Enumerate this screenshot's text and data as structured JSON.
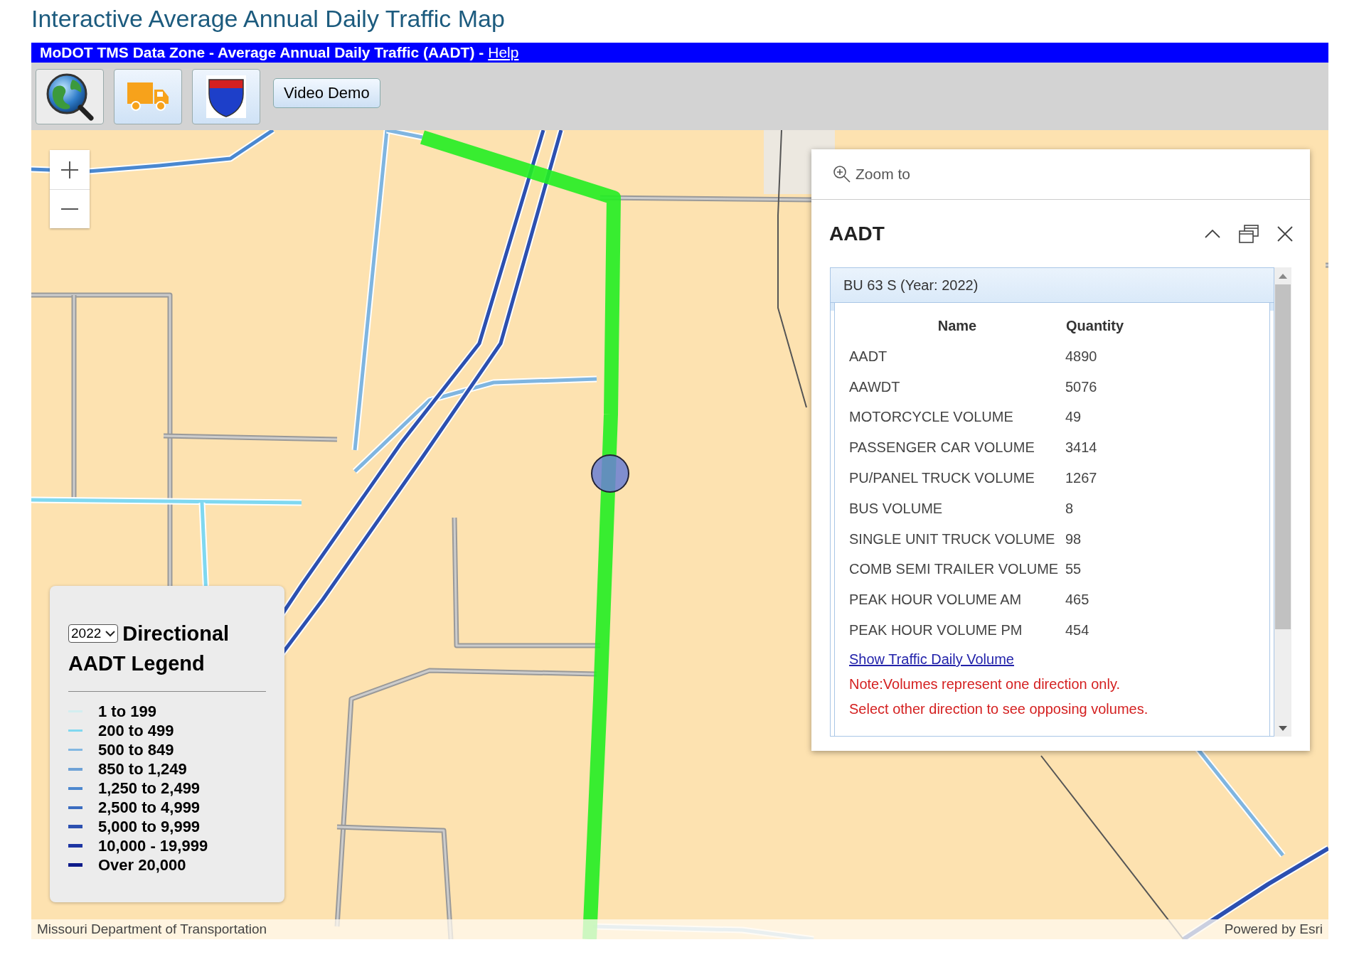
{
  "page_title": "Interactive Average Annual Daily Traffic Map",
  "app_bar": {
    "title": "MoDOT TMS Data Zone - Average Annual Daily Traffic (AADT) -",
    "help_link": "Help"
  },
  "toolbar": {
    "video_demo": "Video Demo"
  },
  "popup": {
    "zoom_to": "Zoom to",
    "title": "AADT",
    "feature_title": "BU 63 S (Year: 2022)",
    "columns": [
      "Name",
      "Quantity"
    ],
    "rows": [
      {
        "name": "AADT",
        "quantity": "4890"
      },
      {
        "name": "AAWDT",
        "quantity": "5076"
      },
      {
        "name": "MOTORCYCLE VOLUME",
        "quantity": "49"
      },
      {
        "name": "PASSENGER CAR VOLUME",
        "quantity": "3414"
      },
      {
        "name": "PU/PANEL TRUCK VOLUME",
        "quantity": "1267"
      },
      {
        "name": "BUS VOLUME",
        "quantity": "8"
      },
      {
        "name": "SINGLE UNIT TRUCK VOLUME",
        "quantity": "98"
      },
      {
        "name": "COMB SEMI TRAILER VOLUME",
        "quantity": "55"
      },
      {
        "name": "PEAK HOUR VOLUME AM",
        "quantity": "465"
      },
      {
        "name": "PEAK HOUR VOLUME PM",
        "quantity": "454"
      }
    ],
    "link": "Show Traffic Daily Volume",
    "notes": [
      "Note:Volumes represent one direction only.",
      "Select other direction to see opposing volumes."
    ]
  },
  "legend": {
    "year": "2022",
    "title_lines": [
      "Directional",
      "AADT Legend"
    ],
    "items": [
      {
        "label": "1 to 199",
        "color": "#d3eef0"
      },
      {
        "label": "200 to 499",
        "color": "#80d8f0"
      },
      {
        "label": "500 to 849",
        "color": "#82b8e2"
      },
      {
        "label": "850 to 1,249",
        "color": "#6ea2d6"
      },
      {
        "label": "1,250 to 2,499",
        "color": "#4d88cf"
      },
      {
        "label": "2,500 to 4,999",
        "color": "#3b6cc0"
      },
      {
        "label": "5,000 to 9,999",
        "color": "#2c50b0"
      },
      {
        "label": "10,000 - 19,999",
        "color": "#1d35a2"
      },
      {
        "label": "Over 20,000",
        "color": "#0d1b8a"
      }
    ]
  },
  "attribution": {
    "source": "Missouri Department of Transportation",
    "powered_by": "Powered by Esri"
  }
}
